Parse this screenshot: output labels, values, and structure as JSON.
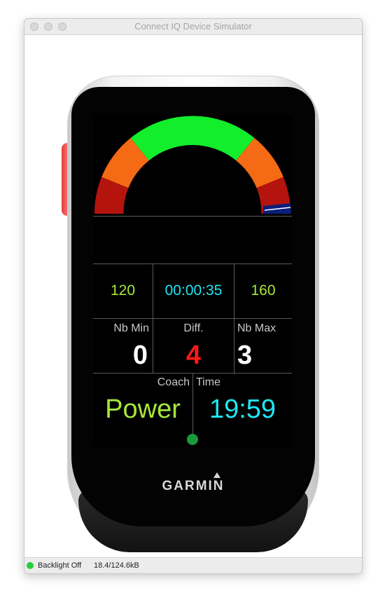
{
  "window": {
    "title": "Connect IQ Device Simulator"
  },
  "gauge": {
    "colors": {
      "red": "#b5130e",
      "orange": "#f56a14",
      "green": "#12ee2b",
      "indicator": "#0a1f7a"
    }
  },
  "screen": {
    "value": "164",
    "target_low": "120",
    "elapsed": "00:00:35",
    "target_high": "160",
    "nb_min_label": "Nb Min",
    "nb_min_value": "0",
    "diff_label": "Diff.",
    "diff_value": "4",
    "nb_max_label": "Nb Max",
    "nb_max_value": "3",
    "coach_label": "Coach",
    "coach_value": "Power",
    "time_label": "Time",
    "time_value": "19:59"
  },
  "colors": {
    "lime": "#a6e83b",
    "cyan": "#1fe6f2",
    "red": "#ff1a1a",
    "white": "#ffffff",
    "gray": "#c8c8c8",
    "dot": "#1a9a3a"
  },
  "device": {
    "brand": "GARMIN"
  },
  "status": {
    "backlight": "Backlight Off",
    "memory": "18.4/124.6kB"
  }
}
